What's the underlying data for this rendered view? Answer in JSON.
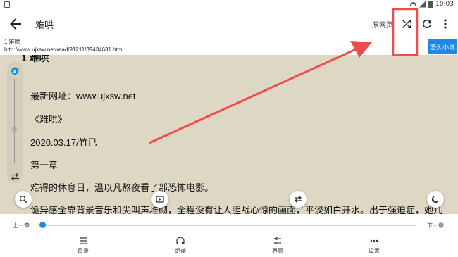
{
  "status_bar": {
    "time": "10:03"
  },
  "toolbar": {
    "title": "难哄",
    "origin_label": "原网页"
  },
  "chapter": {
    "name": "1 难哄",
    "url": "http://www.ujxsw.net/read/91211/39434631.html",
    "source": "悠久小说"
  },
  "reader": {
    "title": "1 难哄",
    "paragraphs": [
      "最新网址：www.ujxsw.net",
      "《难哄》",
      "2020.03.17/竹已",
      "第一章",
      "难得的休息日，温以凡熬夜看了部恐怖电影。",
      "诡异感全靠背景音乐和尖叫声堆砌，全程没有让人胆战心惊的画面，平淡如白开水。出于强迫症，她几"
    ],
    "background_color": "#ddd7c4"
  },
  "navigation": {
    "prev_chapter": "上一章",
    "next_chapter": "下一章",
    "progress": 0.0
  },
  "bottom_bar": {
    "toc": "目录",
    "tts": "朗读",
    "ui": "界面",
    "settings": "设置"
  },
  "annotation": {
    "arrow_color": "#ef4c4c",
    "highlight_target": "shuffle-icon"
  },
  "colors": {
    "accent": "#1e88e5"
  }
}
